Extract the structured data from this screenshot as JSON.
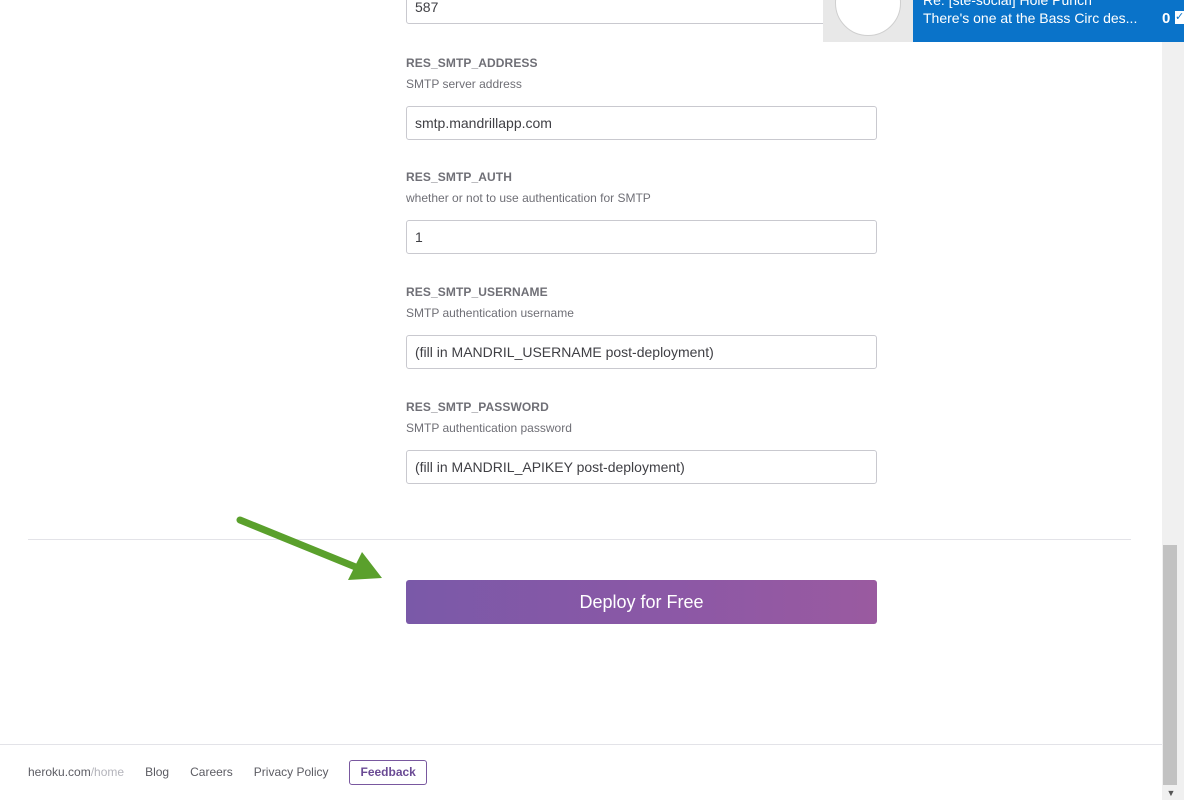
{
  "fields": [
    {
      "label": "",
      "description": "",
      "value": "587"
    },
    {
      "label": "RES_SMTP_ADDRESS",
      "description": "SMTP server address",
      "value": "smtp.mandrillapp.com"
    },
    {
      "label": "RES_SMTP_AUTH",
      "description": "whether or not to use authentication for SMTP",
      "value": "1"
    },
    {
      "label": "RES_SMTP_USERNAME",
      "description": "SMTP authentication username",
      "value": "(fill in MANDRIL_USERNAME post-deployment)"
    },
    {
      "label": "RES_SMTP_PASSWORD",
      "description": "SMTP authentication password",
      "value": "(fill in MANDRIL_APIKEY post-deployment)"
    }
  ],
  "deploy": {
    "label": "Deploy for Free"
  },
  "footer": {
    "home_host": "heroku.com",
    "home_sep": "/",
    "home_path": "home",
    "links": [
      "Blog",
      "Careers",
      "Privacy Policy"
    ],
    "feedback_label": "Feedback"
  },
  "notification": {
    "subject": "Re: [ste-social] Hole Punch",
    "body": "There's one at the Bass Circ des...",
    "count": "0"
  },
  "colors": {
    "deploy_gradient_start": "#7a59a8",
    "deploy_gradient_end": "#9a5aa0",
    "arrow": "#5aa02c",
    "notification_bg": "#0a73c9",
    "feedback_border": "#79589f"
  },
  "icons": {
    "annotation_arrow": "green-arrow-icon",
    "notification_check": "checkbox-icon",
    "scroll_down": "chevron-down-icon"
  }
}
